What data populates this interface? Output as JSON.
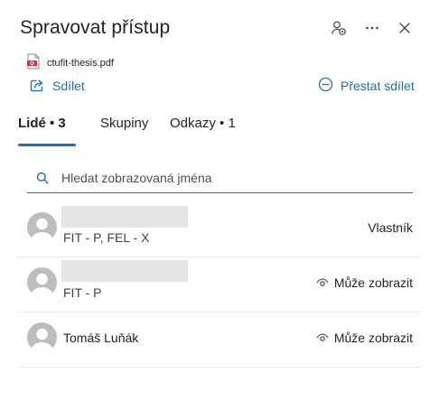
{
  "header": {
    "title": "Spravovat přístup"
  },
  "file": {
    "name": "ctufit-thesis.pdf"
  },
  "actions": {
    "share_label": "Sdílet",
    "stop_share_label": "Přestat sdílet"
  },
  "tabs": [
    {
      "label": "Lidé • 3",
      "active": true
    },
    {
      "label": "Skupiny",
      "active": false
    },
    {
      "label": "Odkazy • 1",
      "active": false
    }
  ],
  "search": {
    "placeholder": "Hledat zobrazovaná jména",
    "value": ""
  },
  "people": [
    {
      "name": "",
      "detail": "FIT - P, FEL - X",
      "role": "Vlastník",
      "role_icon": ""
    },
    {
      "name": "",
      "detail": "FIT - P",
      "role": "Může zobrazit",
      "role_icon": "eye-icon"
    },
    {
      "name": "Tomáš Luňák",
      "detail": "",
      "role": "Může zobrazit",
      "role_icon": "eye-icon"
    }
  ],
  "colors": {
    "accent": "#1b6ec2",
    "text": "#242424",
    "avatar": "#bdbdbd",
    "redaction": "#e6e6e6",
    "pdf_red": "#d13438"
  }
}
